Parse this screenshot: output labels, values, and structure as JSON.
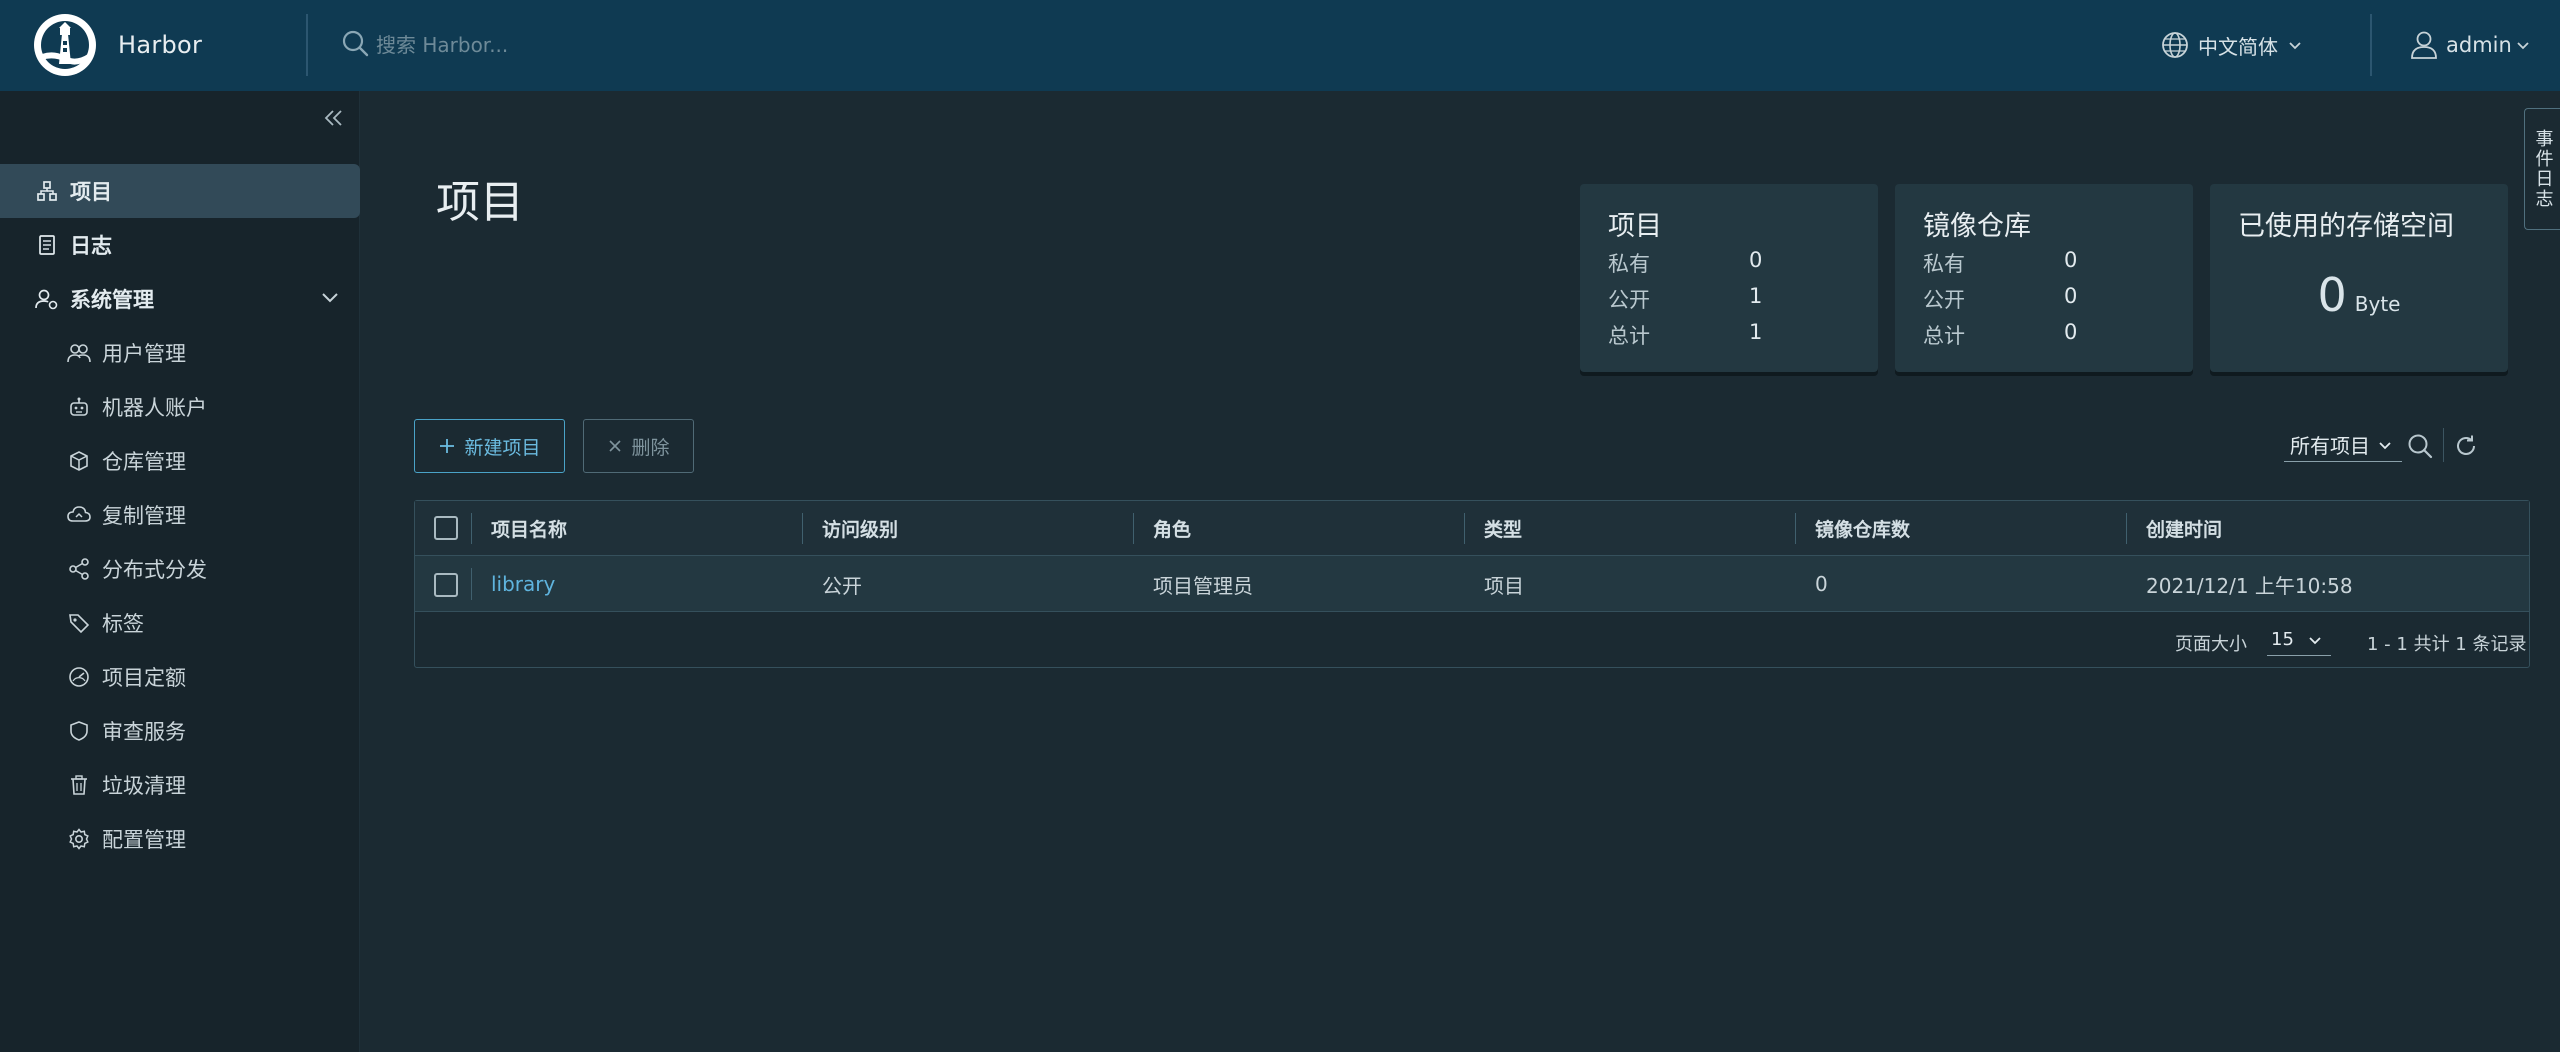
{
  "header": {
    "brand": "Harbor",
    "search_placeholder": "搜索 Harbor...",
    "language": "中文简体",
    "user": "admin"
  },
  "sidebar": {
    "items": [
      {
        "label": "项目",
        "icon": "projects-icon",
        "active": true
      },
      {
        "label": "日志",
        "icon": "logs-icon"
      },
      {
        "label": "系统管理",
        "icon": "admin-icon",
        "expanded": true
      }
    ],
    "sub_items": [
      {
        "label": "用户管理",
        "icon": "users-icon"
      },
      {
        "label": "机器人账户",
        "icon": "robot-icon"
      },
      {
        "label": "仓库管理",
        "icon": "registry-icon"
      },
      {
        "label": "复制管理",
        "icon": "replication-icon"
      },
      {
        "label": "分布式分发",
        "icon": "distribution-icon"
      },
      {
        "label": "标签",
        "icon": "tag-icon"
      },
      {
        "label": "项目定额",
        "icon": "quota-icon"
      },
      {
        "label": "审查服务",
        "icon": "shield-icon"
      },
      {
        "label": "垃圾清理",
        "icon": "trash-icon"
      },
      {
        "label": "配置管理",
        "icon": "gear-icon"
      }
    ]
  },
  "main": {
    "title": "项目",
    "cards": [
      {
        "title": "项目",
        "rows": [
          {
            "label": "私有",
            "value": "0"
          },
          {
            "label": "公开",
            "value": "1"
          },
          {
            "label": "总计",
            "value": "1"
          }
        ]
      },
      {
        "title": "镜像仓库",
        "rows": [
          {
            "label": "私有",
            "value": "0"
          },
          {
            "label": "公开",
            "value": "0"
          },
          {
            "label": "总计",
            "value": "0"
          }
        ]
      }
    ],
    "storage": {
      "title": "已使用的存储空间",
      "value": "0",
      "unit": "Byte"
    },
    "new_button": "新建项目",
    "delete_button": "删除",
    "filter": "所有项目",
    "table": {
      "columns": [
        "项目名称",
        "访问级别",
        "角色",
        "类型",
        "镜像仓库数",
        "创建时间"
      ],
      "rows": [
        {
          "name": "library",
          "access": "公开",
          "role": "项目管理员",
          "type": "项目",
          "repo_count": "0",
          "created": "2021/12/1 上午10:58"
        }
      ],
      "page_size_label": "页面大小",
      "page_size": "15",
      "record_count": "1 - 1 共计 1 条记录"
    },
    "event_log": "事件日志"
  },
  "colors": {
    "header_bg": "#0f3a52",
    "sidebar_bg": "#17242b",
    "main_bg": "#1b2a32",
    "accent": "#5fb4de"
  }
}
